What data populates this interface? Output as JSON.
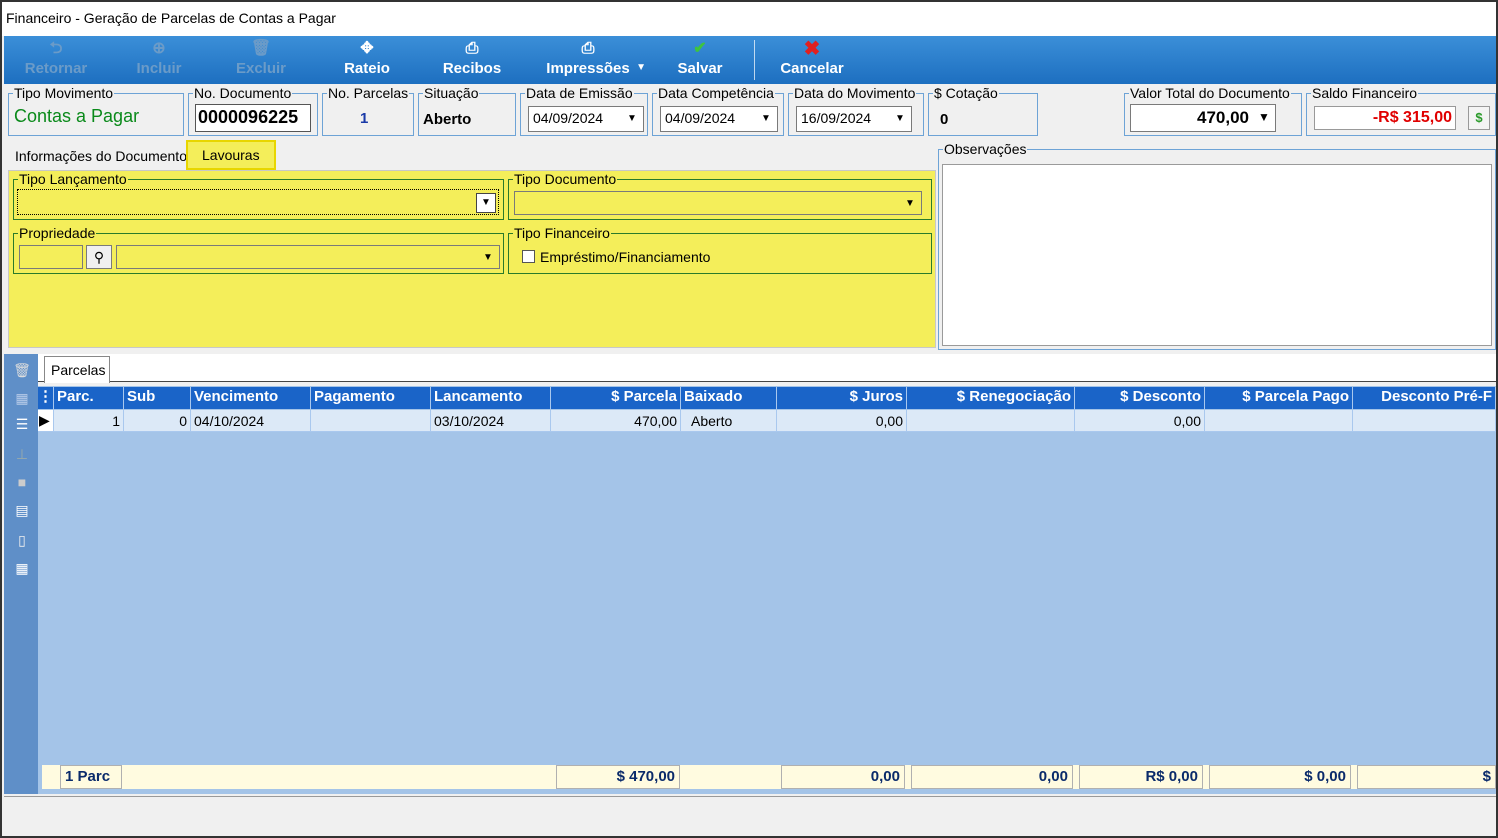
{
  "window": {
    "title": "Financeiro - Geração de Parcelas de Contas a Pagar"
  },
  "toolbar": {
    "retornar": "Retornar",
    "incluir": "Incluir",
    "excluir": "Excluir",
    "rateio": "Rateio",
    "recibos": "Recibos",
    "impressoes": "Impressões",
    "salvar": "Salvar",
    "cancelar": "Cancelar"
  },
  "header": {
    "tipo_movimento": {
      "label": "Tipo Movimento",
      "value": "Contas a Pagar"
    },
    "no_documento": {
      "label": "No. Documento",
      "value": "0000096225"
    },
    "no_parcelas": {
      "label": "No. Parcelas",
      "value": "1"
    },
    "situacao": {
      "label": "Situação",
      "value": "Aberto"
    },
    "data_emissao": {
      "label": "Data de Emissão",
      "value": "04/09/2024"
    },
    "data_competencia": {
      "label": "Data Competência",
      "value": "04/09/2024"
    },
    "data_movimento": {
      "label": "Data do Movimento",
      "value": "16/09/2024"
    },
    "cotacao": {
      "label": "$ Cotação",
      "value": "0"
    },
    "valor_total": {
      "label": "Valor Total do Documento",
      "value": "470,00"
    },
    "saldo_financeiro": {
      "label": "Saldo Financeiro",
      "value": "-R$ 315,00"
    }
  },
  "tabs": {
    "info": "Informações do Documento",
    "lavouras": "Lavouras"
  },
  "form": {
    "tipo_lancamento": "Tipo Lançamento",
    "tipo_documento": "Tipo Documento",
    "propriedade": "Propriedade",
    "tipo_financeiro": "Tipo Financeiro",
    "emprestimo": "Empréstimo/Financiamento"
  },
  "observacoes": {
    "label": "Observações"
  },
  "parcelas_tab": "Parcelas",
  "grid": {
    "columns": [
      "Parc.",
      "Sub",
      "Vencimento",
      "Pagamento",
      "Lancamento",
      "$ Parcela",
      "Baixado",
      "$ Juros",
      "$ Renegociação",
      "$ Desconto",
      "$ Parcela Pago",
      "Desconto Pré-F"
    ],
    "row": {
      "parc": "1",
      "sub": "0",
      "vencimento": "04/10/2024",
      "pagamento": "",
      "lancamento": "03/10/2024",
      "parcela": "470,00",
      "baixado": "Aberto",
      "juros": "0,00",
      "renegociacao": "",
      "desconto": "0,00",
      "parcela_pago": "",
      "desconto_pre": ""
    }
  },
  "footer": {
    "count": "1 Parc",
    "parcela": "$ 470,00",
    "juros": "0,00",
    "renegociacao": "0,00",
    "desconto": "R$ 0,00",
    "parcela_pago": "$ 0,00",
    "desconto_pre": "$"
  },
  "colors": {
    "toolbar": "#1d6fc0",
    "highlight": "#f4ee5a",
    "grid_header": "#1a64c8",
    "grid_body": "#a4c4e8"
  }
}
